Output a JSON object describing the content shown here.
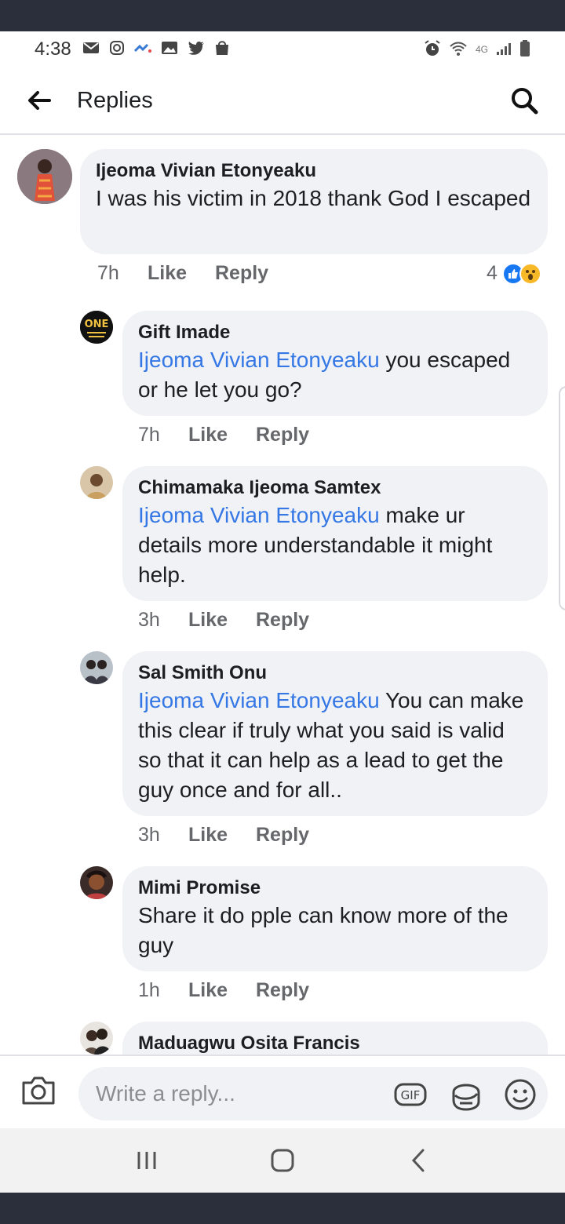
{
  "status_bar": {
    "time": "4:38",
    "network": "4G",
    "left_icons": [
      "mail-icon",
      "instagram-icon",
      "messenger-icon",
      "gallery-icon",
      "twitter-icon",
      "shopping-bag-icon"
    ],
    "right_icons": [
      "alarm-icon",
      "wifi-icon",
      "signal-icon",
      "battery-icon"
    ]
  },
  "header": {
    "title": "Replies"
  },
  "comments": [
    {
      "author": "Ijeoma Vivian Etonyeaku",
      "mention": "",
      "text": "I was his victim in 2018 thank God I escaped",
      "time": "7h",
      "like_label": "Like",
      "reply_label": "Reply",
      "reaction_count": "4"
    },
    {
      "author": "Gift Imade",
      "mention": "Ijeoma Vivian Etonyeaku",
      "text": " you escaped or he let you go?",
      "time": "7h",
      "like_label": "Like",
      "reply_label": "Reply"
    },
    {
      "author": "Chimamaka Ijeoma Samtex",
      "mention": "Ijeoma Vivian Etonyeaku",
      "text": " make ur details more understandable it might help.",
      "time": "3h",
      "like_label": "Like",
      "reply_label": "Reply"
    },
    {
      "author": "Sal Smith Onu",
      "mention": "Ijeoma Vivian Etonyeaku",
      "text": " You can make this clear if truly what you said is valid so that it can help as a lead to get the guy once and for all..",
      "time": "3h",
      "like_label": "Like",
      "reply_label": "Reply"
    },
    {
      "author": "Mimi Promise",
      "mention": "",
      "text": "Share it do pple can know more of the guy",
      "time": "1h",
      "like_label": "Like",
      "reply_label": "Reply"
    },
    {
      "author": "Maduagwu Osita Francis",
      "mention": "",
      "text": "",
      "time": "",
      "like_label": "",
      "reply_label": ""
    }
  ],
  "avatar_labels": {
    "gift_imade": "ONE"
  },
  "composer": {
    "placeholder": "Write a reply...",
    "gif_label": "GIF"
  },
  "colors": {
    "mention": "#3578e5",
    "bubble": "#f0f2f5",
    "like_reaction": "#1877f2",
    "wow_reaction": "#f7b928"
  }
}
